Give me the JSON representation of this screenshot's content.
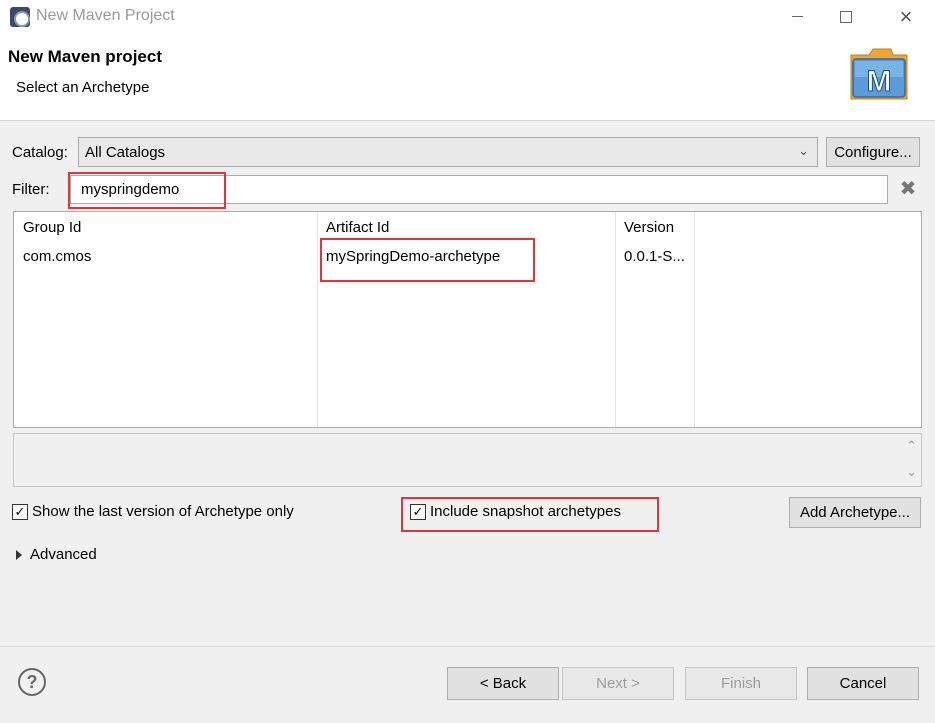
{
  "window": {
    "title": "New Maven Project"
  },
  "header": {
    "title": "New Maven project",
    "subtitle": "Select an Archetype",
    "logo_letter": "M"
  },
  "catalog": {
    "label": "Catalog:",
    "selected": "All Catalogs",
    "configure_label": "Configure..."
  },
  "filter": {
    "label": "Filter:",
    "value": "myspringdemo"
  },
  "table": {
    "columns": [
      "Group Id",
      "Artifact Id",
      "Version"
    ],
    "rows": [
      {
        "group_id": "com.cmos",
        "artifact_id": "mySpringDemo-archetype",
        "version": "0.0.1-S..."
      }
    ]
  },
  "options": {
    "show_last_version_label": "Show the last version of Archetype only",
    "show_last_version_checked": true,
    "include_snapshot_label": "Include snapshot archetypes",
    "include_snapshot_checked": true,
    "add_archetype_label": "Add Archetype..."
  },
  "advanced": {
    "label": "Advanced"
  },
  "footer": {
    "back_label": "< Back",
    "next_label": "Next >",
    "finish_label": "Finish",
    "cancel_label": "Cancel",
    "help_glyph": "?"
  },
  "colors": {
    "highlight": "#e0353a",
    "maven_logo_blue": "#3d7fc1",
    "maven_folder_orange": "#f0a532"
  },
  "icons": {
    "app": "eclipse-icon",
    "clear_filter": "clear-x-icon",
    "dropdown": "chevron-down-icon",
    "expand": "triangle-right-icon",
    "help": "help-circle-icon"
  }
}
